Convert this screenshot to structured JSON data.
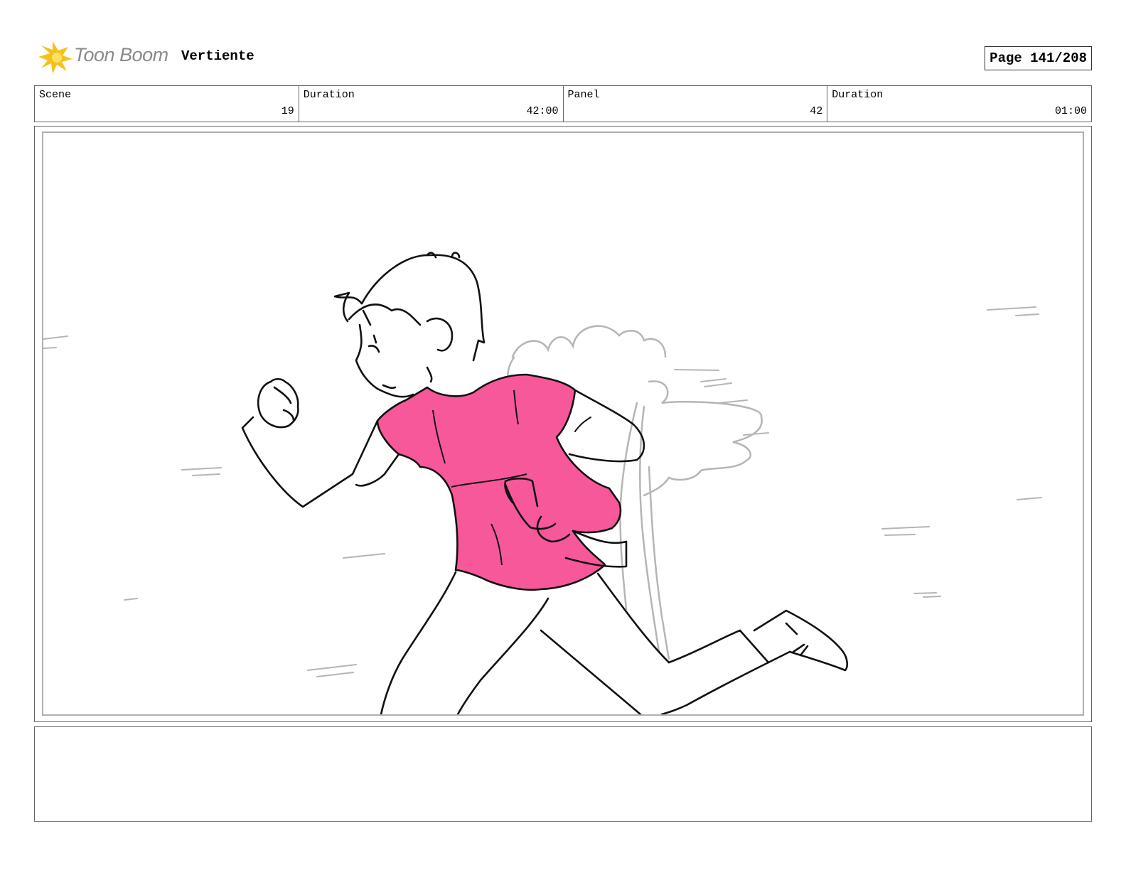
{
  "header": {
    "logo_text": "Toon Boom",
    "project_title": "Vertiente",
    "page_label": "Page 141/208"
  },
  "info": [
    {
      "label": "Scene",
      "value": "19"
    },
    {
      "label": "Duration",
      "value": "42:00"
    },
    {
      "label": "Panel",
      "value": "42"
    },
    {
      "label": "Duration",
      "value": "01:00"
    }
  ],
  "panel": {
    "illustration": "boy-running-sketch",
    "shirt_color": "#f7589a",
    "line_color": "#111111",
    "background_sketch_color": "#b5b5b5"
  },
  "notes": {
    "text": ""
  }
}
